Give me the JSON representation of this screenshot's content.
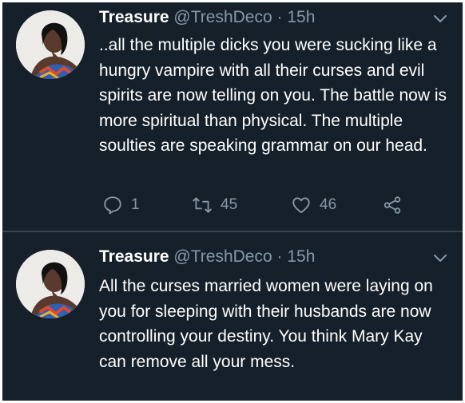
{
  "tweets": [
    {
      "name": "Treasure",
      "handle": "@TreshDeco",
      "separator": "·",
      "time": "15h",
      "text": "..all the multiple dicks you were sucking like a hungry vampire with all their curses and evil spirits are now telling on you. The battle now is more spiritual than physical. The multiple soulties are speaking grammar on our head.",
      "replies": "1",
      "retweets": "45",
      "likes": "46"
    },
    {
      "name": "Treasure",
      "handle": "@TreshDeco",
      "separator": "·",
      "time": "15h",
      "text": "All the curses married women were laying on you for sleeping with their husbands are now controlling your destiny. You think Mary Kay can remove all your mess."
    }
  ],
  "colors": {
    "background": "#15202b",
    "text": "#ffffff",
    "secondary": "#8899a6",
    "divider": "#38444d"
  },
  "icons": [
    "chevron-down-icon",
    "reply-icon",
    "retweet-icon",
    "like-icon",
    "share-icon"
  ]
}
